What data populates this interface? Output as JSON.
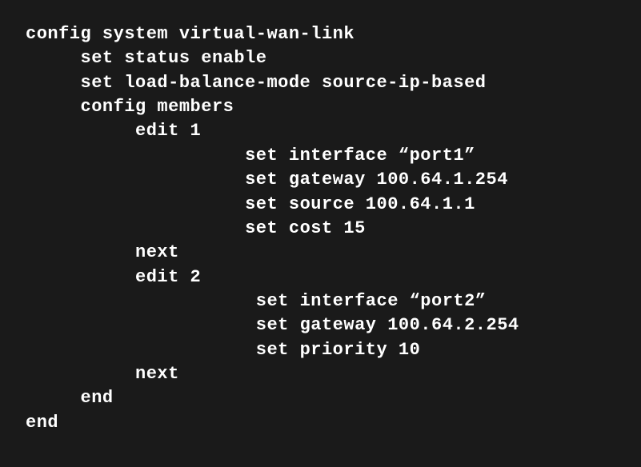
{
  "config": {
    "lines": [
      {
        "indent": 0,
        "text": "config system virtual-wan-link"
      },
      {
        "indent": 1,
        "text": "set status enable"
      },
      {
        "indent": 1,
        "text": "set load-balance-mode source-ip-based"
      },
      {
        "indent": 1,
        "text": "config members"
      },
      {
        "indent": 2,
        "text": "edit 1"
      },
      {
        "indent": 4,
        "text": "set interface “port1”"
      },
      {
        "indent": 4,
        "text": "set gateway 100.64.1.254"
      },
      {
        "indent": 4,
        "text": "set source 100.64.1.1"
      },
      {
        "indent": 4,
        "text": "set cost 15"
      },
      {
        "indent": 2,
        "text": "next"
      },
      {
        "indent": 2,
        "text": "edit 2"
      },
      {
        "indent": 4,
        "text": " set interface “port2”"
      },
      {
        "indent": 4,
        "text": " set gateway 100.64.2.254"
      },
      {
        "indent": 4,
        "text": " set priority 10"
      },
      {
        "indent": 2,
        "text": "next"
      },
      {
        "indent": 1,
        "text": "end"
      },
      {
        "indent": 0,
        "text": "end"
      }
    ],
    "indentUnit": "     "
  }
}
